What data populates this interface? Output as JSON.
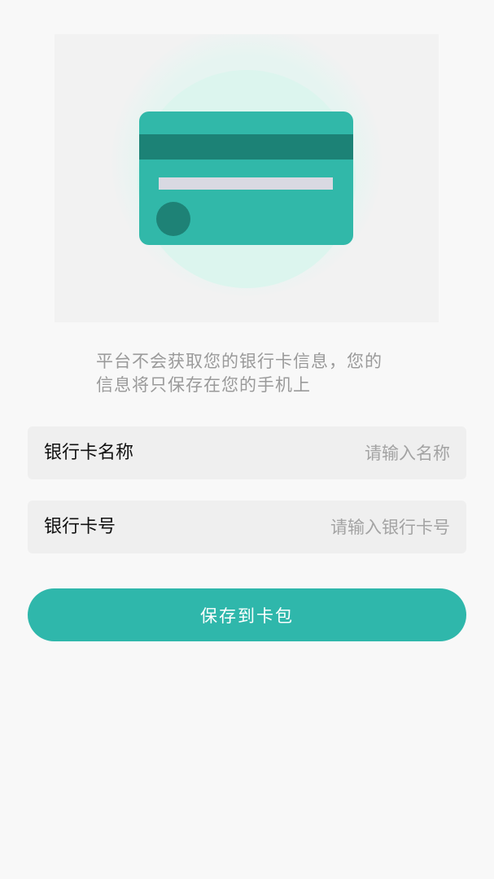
{
  "hero": {
    "illustration": "bank-card-illustration",
    "colors": {
      "card": "#31b8a9",
      "stripe": "#1c8276",
      "halo": "#dcf5ee"
    }
  },
  "notice": {
    "text": "平台不会获取您的银行卡信息，您的信息将只保存在您的手机上"
  },
  "form": {
    "bank_name": {
      "label": "银行卡名称",
      "placeholder": "请输入名称",
      "value": ""
    },
    "card_number": {
      "label": "银行卡号",
      "placeholder": "请输入银行卡号",
      "value": ""
    }
  },
  "actions": {
    "save_label": "保存到卡包",
    "accent_color": "#2fb7ab"
  }
}
